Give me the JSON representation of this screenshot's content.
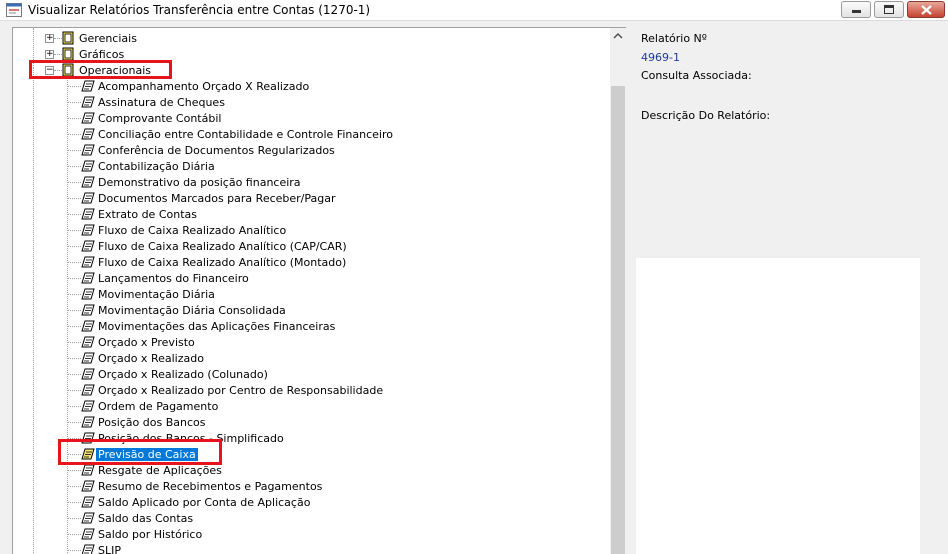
{
  "window": {
    "title": "Visualizar Relatórios Transferência entre Contas (1270-1)",
    "controls": [
      "minimize",
      "maximize",
      "close"
    ]
  },
  "tree": {
    "groups": [
      {
        "label": "Gerenciais",
        "expanded": false
      },
      {
        "label": "Gráficos",
        "expanded": false
      },
      {
        "label": "Operacionais",
        "expanded": true
      }
    ],
    "reports": [
      "Acompanhamento Orçado X Realizado",
      "Assinatura de Cheques",
      "Comprovante Contábil",
      "Conciliação entre Contabilidade e Controle Financeiro",
      "Conferência de Documentos Regularizados",
      "Contabilização Diária",
      "Demonstrativo da posição financeira",
      "Documentos Marcados para Receber/Pagar",
      "Extrato de Contas",
      "Fluxo de Caixa Realizado Analítico",
      "Fluxo de Caixa Realizado Analítico (CAP/CAR)",
      "Fluxo de Caixa Realizado Analítico (Montado)",
      "Lançamentos do Financeiro",
      "Movimentação Diária",
      "Movimentação Diária Consolidada",
      "Movimentações das Aplicações Financeiras",
      "Orçado x Previsto",
      "Orçado x Realizado",
      "Orçado x Realizado (Colunado)",
      "Orçado x Realizado por Centro de Responsabilidade",
      "Ordem de Pagamento",
      "Posição dos Bancos",
      "Posição dos Bancos - Simplificado",
      "Previsão de Caixa",
      "Resgate de Aplicações",
      "Resumo de Recebimentos e Pagamentos",
      "Saldo Aplicado por Conta de Aplicação",
      "Saldo das Contas",
      "Saldo por Histórico",
      "SLIP"
    ],
    "selected_report": "Previsão de Caixa"
  },
  "info": {
    "report_number_label": "Relatório Nº",
    "report_number_value": "4969-1",
    "query_label": "Consulta Associada:",
    "description_label": "Descrição Do Relatório:"
  },
  "colors": {
    "selection": "#0078d7",
    "highlight_box": "#e8141d",
    "value_text": "#1f3a93"
  }
}
